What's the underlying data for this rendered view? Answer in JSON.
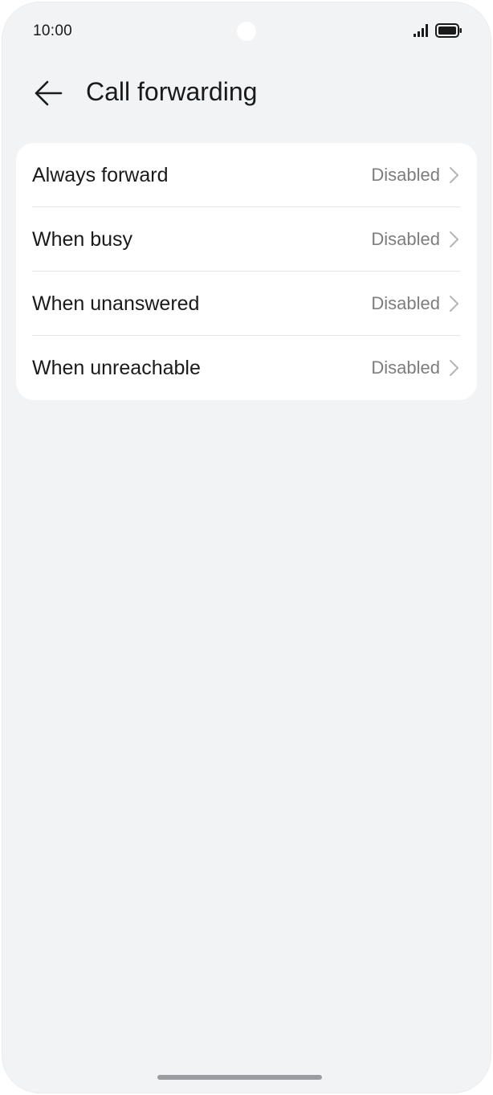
{
  "status_bar": {
    "time": "10:00",
    "icons": [
      "signal-icon",
      "battery-icon"
    ]
  },
  "header": {
    "back_icon": "back-arrow-icon",
    "title": "Call forwarding"
  },
  "forwarding_options": [
    {
      "label": "Always forward",
      "value": "Disabled"
    },
    {
      "label": "When busy",
      "value": "Disabled"
    },
    {
      "label": "When unanswered",
      "value": "Disabled"
    },
    {
      "label": "When unreachable",
      "value": "Disabled"
    }
  ],
  "colors": {
    "background": "#f2f3f5",
    "card": "#ffffff",
    "text_primary": "#1a1a1a",
    "text_secondary": "#7d7d80",
    "divider": "#e6e6e8"
  }
}
